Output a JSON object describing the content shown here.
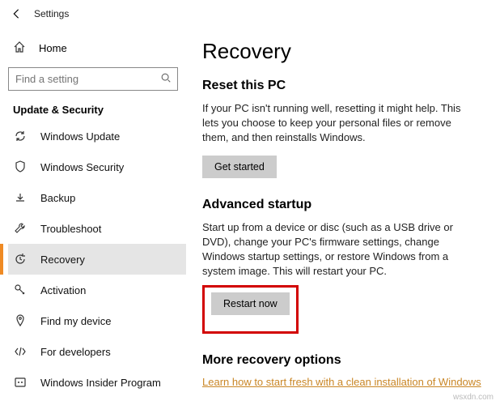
{
  "window": {
    "title": "Settings"
  },
  "sidebar": {
    "home": "Home",
    "search_placeholder": "Find a setting",
    "category": "Update & Security",
    "items": [
      {
        "label": "Windows Update"
      },
      {
        "label": "Windows Security"
      },
      {
        "label": "Backup"
      },
      {
        "label": "Troubleshoot"
      },
      {
        "label": "Recovery"
      },
      {
        "label": "Activation"
      },
      {
        "label": "Find my device"
      },
      {
        "label": "For developers"
      },
      {
        "label": "Windows Insider Program"
      }
    ]
  },
  "main": {
    "title": "Recovery",
    "reset": {
      "heading": "Reset this PC",
      "desc": "If your PC isn't running well, resetting it might help. This lets you choose to keep your personal files or remove them, and then reinstalls Windows.",
      "button": "Get started"
    },
    "advanced": {
      "heading": "Advanced startup",
      "desc": "Start up from a device or disc (such as a USB drive or DVD), change your PC's firmware settings, change Windows startup settings, or restore Windows from a system image. This will restart your PC.",
      "button": "Restart now"
    },
    "more": {
      "heading": "More recovery options",
      "link": "Learn how to start fresh with a clean installation of Windows"
    }
  },
  "watermark": "wsxdn.com"
}
